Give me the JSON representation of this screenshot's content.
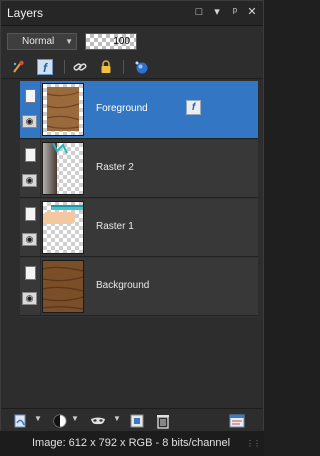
{
  "panel": {
    "title": "Layers",
    "controls": {
      "restore_icon": "□",
      "options_icon": "▾",
      "pin_icon": "ᵖ",
      "close_icon": "✕"
    }
  },
  "blend": {
    "mode": "Normal",
    "opacity": "100"
  },
  "toolbar_icons": [
    "brush-icon",
    "fx-icon",
    "link-icon",
    "lock-icon",
    "mask-icon"
  ],
  "layers": [
    {
      "name": "Foreground",
      "selected": true,
      "has_fx": true,
      "fx_label": "f",
      "thumb": "wood"
    },
    {
      "name": "Raster 2",
      "selected": false,
      "has_fx": false,
      "thumb": "raster2"
    },
    {
      "name": "Raster 1",
      "selected": false,
      "has_fx": false,
      "thumb": "raster1"
    },
    {
      "name": "Background",
      "selected": false,
      "has_fx": false,
      "thumb": "background"
    }
  ],
  "bottom_toolbar": {
    "icons": [
      "new-layer-icon",
      "adjustment-layer-icon",
      "mask-icon",
      "group-icon",
      "delete-icon",
      "properties-icon"
    ]
  },
  "status": {
    "text": "Image:  612 x 792 x RGB - 8 bits/channel"
  },
  "colors": {
    "selected": "#3377c4",
    "panel": "#2d2d2d",
    "accent_fx": "#2b5fa6"
  }
}
